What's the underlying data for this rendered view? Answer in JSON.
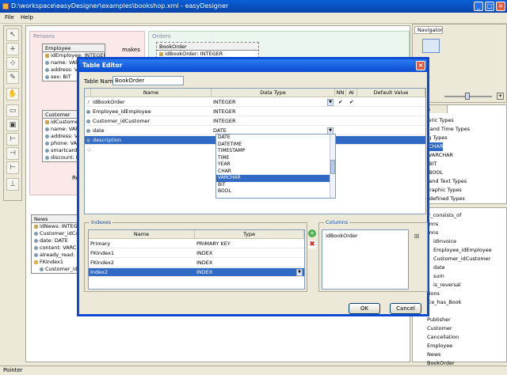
{
  "window": {
    "title": "D:\\workspace\\easyDesigner\\examples\\bookshop.xml - easyDesigner"
  },
  "menu": [
    "File",
    "Help"
  ],
  "canvas": {
    "persons_label": "Persons",
    "orders_label": "Orders",
    "makes_label": "makes",
    "employee": {
      "title": "Employee",
      "rows": [
        "idEmployee: INTEGER",
        "name: VARCHAR",
        "address: VARCHAR",
        "sex: BIT"
      ]
    },
    "customer": {
      "title": "Customer",
      "rows": [
        "idCustomer: INTEGER",
        "name: VARCHAR",
        "address: VARCHAR",
        "phone: VARCHAR",
        "smartcard: BIT",
        "discount: NUMERIC"
      ]
    },
    "bookorder": {
      "title": "BookOrder",
      "rows": [
        "idBookOrder: INTEGER"
      ]
    },
    "news": {
      "title": "News",
      "rows": [
        "idNews: INTEGER",
        "Customer_idCustomer: INTEGER",
        "date: DATE",
        "content: VARCHAR",
        "already_read: BIT",
        "FKIndex1",
        "Customer_idCustomer"
      ]
    },
    "re_label": "Re"
  },
  "navigator": {
    "tab": "Navigator"
  },
  "types": {
    "tab": "Types",
    "items": [
      "Numeric Types",
      "Date and Time Types",
      "String Types",
      "CHAR",
      "VARCHAR",
      "BIT",
      "BOOL",
      "Blob and Text Types",
      "Geographic Types",
      "User defined Types"
    ]
  },
  "tree": {
    "items": [
      "Order_consists_of",
      "Columns",
      "Columns",
      "idInvoice",
      "Employee_idEmployee",
      "Customer_idCustomer",
      "date",
      "sum",
      "is_reversal",
      "Relations",
      "Invoice_has_Book",
      "Book",
      "Publisher",
      "Customer",
      "Cancellation",
      "Employee",
      "News",
      "BookOrder"
    ]
  },
  "status": "Pointer",
  "dialog": {
    "title": "Table Editor",
    "table_name_label": "Table Name:",
    "table_name_value": "BookOrder",
    "columns_headers": [
      "Name",
      "Data Type",
      "NN",
      "AI",
      "Default Value"
    ],
    "columns": [
      {
        "name": "idBookOrder",
        "type": "INTEGER",
        "nn": "✔",
        "ai": "✔"
      },
      {
        "name": "Employee_idEmployee",
        "type": "INTEGER",
        "nn": "",
        "ai": ""
      },
      {
        "name": "Customer_idCustomer",
        "type": "INTEGER",
        "nn": "",
        "ai": ""
      },
      {
        "name": "date",
        "type": "DATE",
        "nn": "",
        "ai": ""
      },
      {
        "name": "description",
        "type": "INTEGER",
        "nn": "",
        "ai": ""
      }
    ],
    "type_options": [
      "DATE",
      "DATETIME",
      "TIMESTAMP",
      "TIME",
      "YEAR",
      "CHAR",
      "VARCHAR",
      "BIT",
      "BOOL"
    ],
    "type_selected": "VARCHAR",
    "indexes_label": "Indexes",
    "index_headers": [
      "Name",
      "Type"
    ],
    "indexes": [
      {
        "name": "Primary",
        "type": "PRIMARY KEY"
      },
      {
        "name": "FKIndex1",
        "type": "INDEX"
      },
      {
        "name": "FKIndex2",
        "type": "INDEX"
      },
      {
        "name": "Index2",
        "type": "INDEX"
      }
    ],
    "columns_label": "Columns",
    "index_columns": [
      "idBookOrder"
    ],
    "ok": "OK",
    "cancel": "Cancel"
  }
}
